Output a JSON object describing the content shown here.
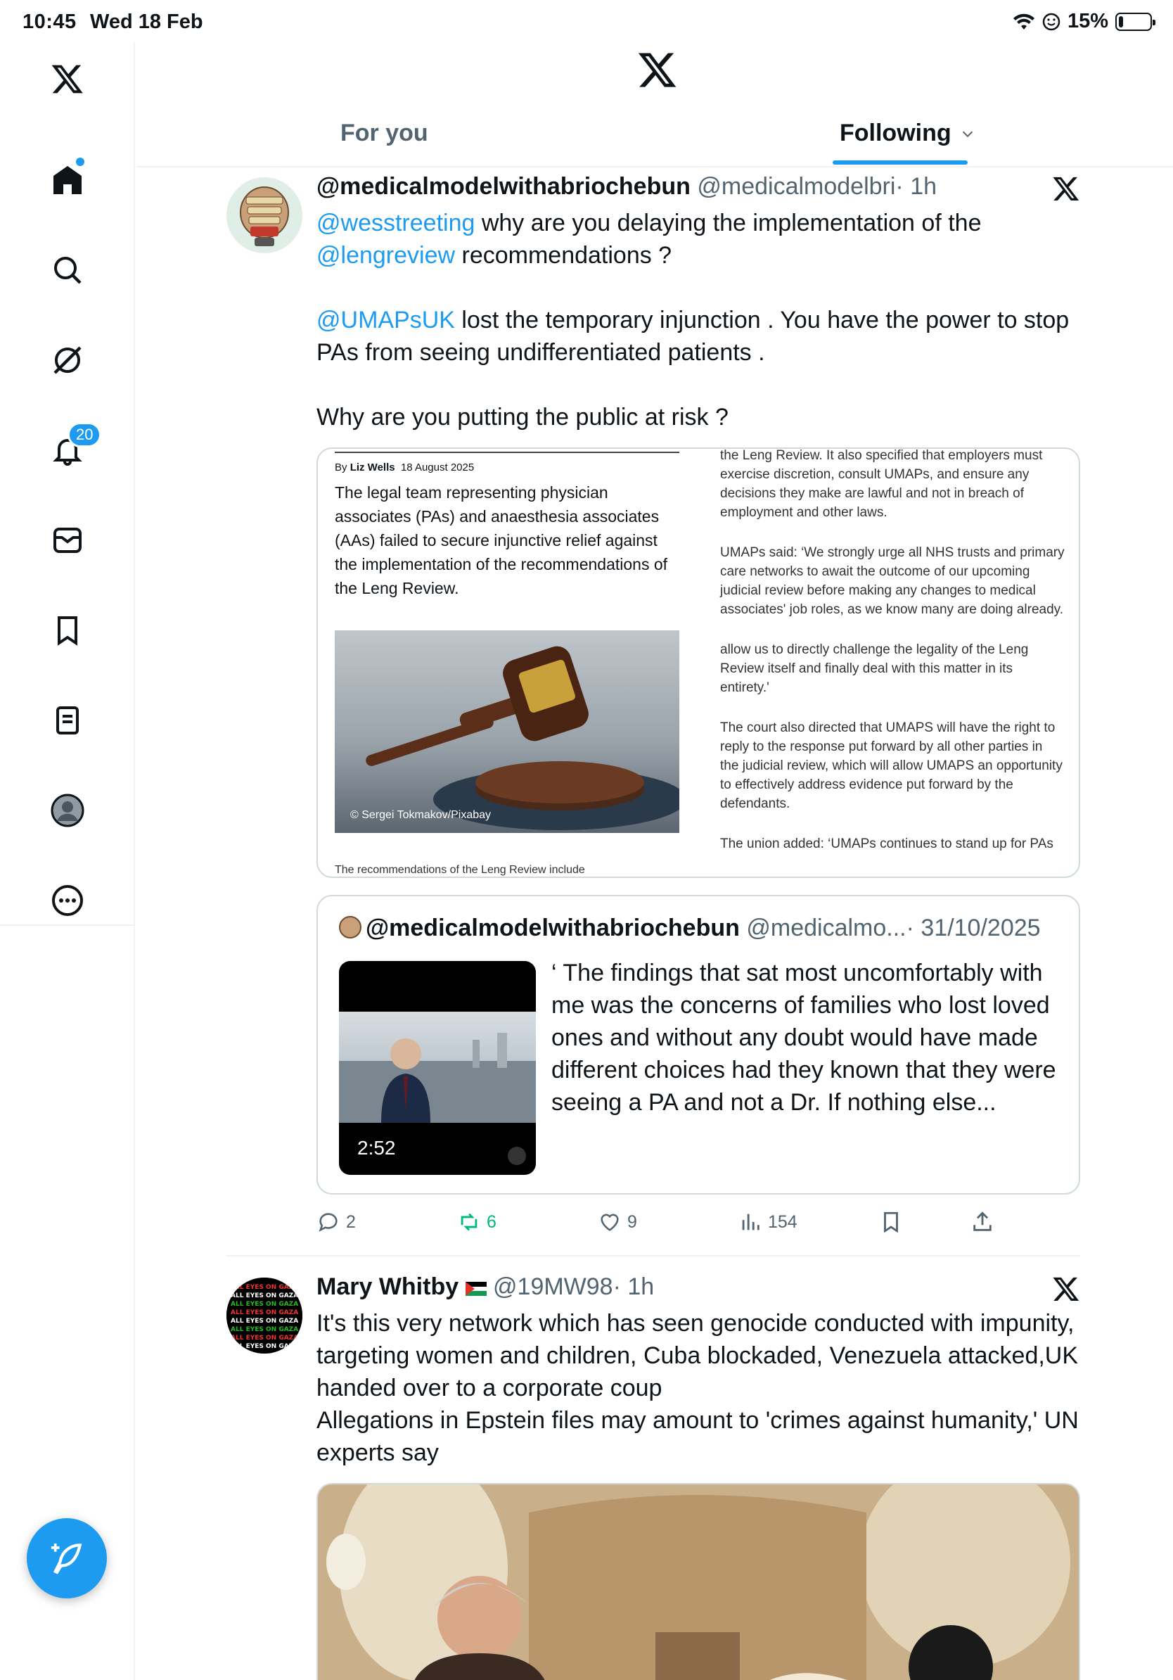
{
  "status": {
    "time": "10:45",
    "date": "Wed 18 Feb",
    "battery": "15%",
    "battery_level": 0.15
  },
  "sidebar": {
    "items": [
      {
        "name": "home",
        "icon": "home-icon"
      },
      {
        "name": "search",
        "icon": "search-icon"
      },
      {
        "name": "grok",
        "icon": "grok-icon"
      },
      {
        "name": "notifications",
        "icon": "bell-icon",
        "badge": "20"
      },
      {
        "name": "messages",
        "icon": "mail-icon"
      },
      {
        "name": "bookmarks",
        "icon": "bookmark-icon"
      },
      {
        "name": "lists",
        "icon": "list-icon"
      },
      {
        "name": "profile",
        "icon": "avatar-icon"
      },
      {
        "name": "more",
        "icon": "more-icon"
      }
    ],
    "compose": "feather-icon"
  },
  "header": {
    "tabs": [
      {
        "label": "For you"
      },
      {
        "label": "Following"
      }
    ]
  },
  "posts": [
    {
      "name": "@medicalmodelwithabriochebun",
      "handle": "@medicalmodelbri",
      "time": "· 1h",
      "text": {
        "mention1": "@wesstreeting",
        "p1a": " why are you delaying the implementation of the ",
        "mention2": "@lengreview",
        "p1b": " recommendations ?",
        "mention3": "@UMAPsUK",
        "p2": " lost the temporary injunction . You have the power to stop PAs from seeing undifferentiated patients .",
        "p3": "Why are you putting the public at risk ?"
      },
      "article": {
        "byline_prefix": "By ",
        "author": "Liz Wells",
        "date": "18 August 2025",
        "lead": "The legal team representing physician associates (PAs) and anaesthesia associates (AAs) failed to secure injunctive relief against the implementation of the recommendations of the Leng Review.",
        "photo_credit": "© Sergei Tokmakov/Pixabay",
        "cut_bottom": "The recommendations of the Leng Review include",
        "right_paragraphs": [
          "the Leng Review. It also specified that employers must exercise discretion, consult UMAPs, and ensure any decisions they make are lawful and not in breach of employment and other laws.",
          "UMAPs said: ‘We strongly urge all NHS trusts and primary care networks to await the outcome of our upcoming judicial review before making any changes to medical associates' job roles, as we know many are doing already.",
          "allow us to directly challenge the legality of the Leng Review itself and finally deal with this matter in its entirety.'",
          "The court also directed that UMAPS will have the right to reply to the response put forward by all other parties in the judicial review, which will allow UMAPS an opportunity to effectively address evidence put forward by the defendants.",
          "The union added: ‘UMAPs continues to stand up for PAs"
        ]
      },
      "quote": {
        "name": "@medicalmodelwithabriochebun",
        "handle": "@medicalmo...",
        "date": "· 31/10/2025",
        "duration": "2:52",
        "text": "‘ The findings that sat most uncomfortably with me was the concerns of families who lost loved ones and without any doubt would have made different choices had they known that they were seeing a PA and not a Dr. If nothing else..."
      },
      "actions": {
        "replies": "2",
        "reposts": "6",
        "likes": "9",
        "views": "154"
      }
    },
    {
      "name": "Mary Whitby",
      "flag": "🇵🇸",
      "handle": "@19MW98",
      "time": "· 1h",
      "text": "It's this very network which has seen genocide conducted with impunity, targeting women and children, Cuba blockaded, Venezuela attacked,UK handed over to a corporate coup\nAllegations in Epstein files may amount to 'crimes against humanity,' UN experts say",
      "avatar_text": "ALL EYES ON GAZA CITY"
    }
  ],
  "colors": {
    "accent": "#1d9bf0",
    "repost": "#00ba7c",
    "muted": "#536471",
    "border": "#cfd9de"
  }
}
